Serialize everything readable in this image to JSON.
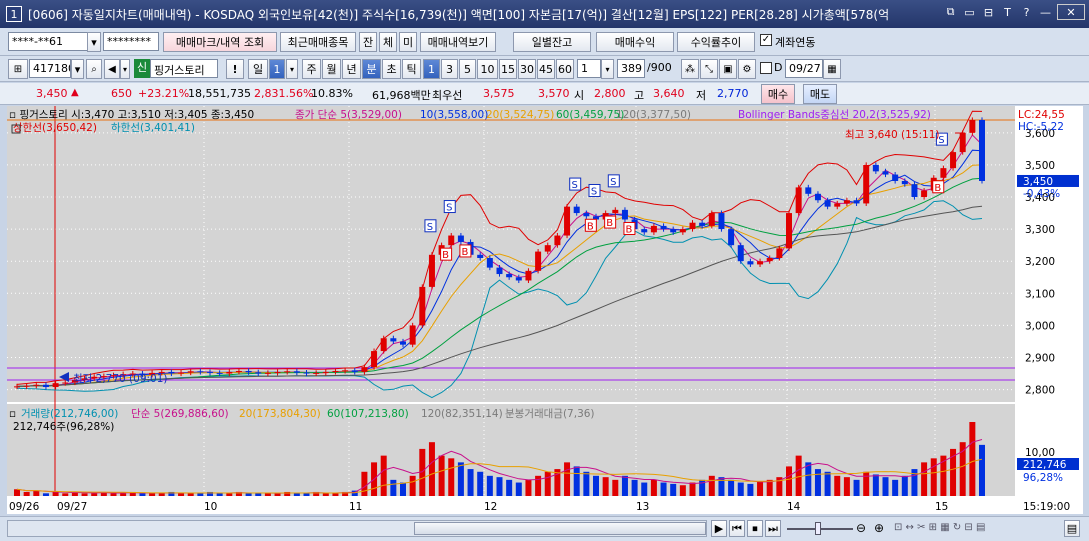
{
  "window": {
    "number": "1",
    "title": "[0606] 자동일지차트(매매내역) - KOSDAQ 외국인보유[42(천)] 주식수[16,739(천)] 액면[100] 자본금[17(억)] 결산[12월] EPS[122] PER[28.28] 시가총액[578(억",
    "buttons": [
      "⧉",
      "▭",
      "⊟",
      "T",
      "?",
      "—",
      "✕"
    ]
  },
  "toolbar1": {
    "account": "****-**61",
    "password": "********",
    "btn_trade_mark": "매매마크/내역 조회",
    "btn_recent": "최근매매종목",
    "btn_jan": "잔",
    "btn_che": "체",
    "btn_mi": "미",
    "btn_history": "매매내역보기",
    "btn_daily_balance": "일별잔고",
    "btn_pnl": "매매수익",
    "btn_return": "수익률추이",
    "link_account_label": "계좌연동",
    "link_account_checked": true
  },
  "toolbar2": {
    "code": "417180",
    "shin": "신",
    "name": "핑거스토리",
    "alert": "!",
    "period_il": "일",
    "period_num": "1",
    "period_ju": "주",
    "period_wol": "월",
    "period_nyeon": "년",
    "period_bun": "분",
    "period_cho": "초",
    "period_tik": "틱",
    "minutes": [
      "1",
      "3",
      "5",
      "10",
      "15",
      "30",
      "45",
      "60"
    ],
    "interval_value": "1",
    "count": "389",
    "count_total": "/900",
    "d_label": "D",
    "date": "09/27"
  },
  "pricebar": {
    "price": "3,450",
    "arrow": "▲",
    "change": "650",
    "change_pct": "+23.21%",
    "volume": "18,551,735",
    "volume_pct": "2,831.56%",
    "turnover": "10.83%",
    "trade_value": "61,968백만",
    "best_ask_label": "최우선",
    "best_ask": "3,575",
    "best_bid": "3,570",
    "open_label": "시",
    "open": "2,800",
    "high_label": "고",
    "high": "3,640",
    "low_label": "저",
    "low": "2,770",
    "buy_btn": "매수",
    "sell_btn": "매도"
  },
  "chart_data": {
    "type": "line",
    "title": "핑거스토리 시:3,470 고:3,510 저:3,405 종:3,450",
    "legend_main": [
      {
        "name": "종가 단순 5(3,529,00)",
        "color": "#c8108c"
      },
      {
        "name": "10(3,558,00)",
        "color": "#0030e0"
      },
      {
        "name": "20(3,524,75)",
        "color": "#e8a000"
      },
      {
        "name": "60(3,459,75)",
        "color": "#00a040"
      },
      {
        "name": "120(3,377,50)",
        "color": "#7a7a7a"
      },
      {
        "name": "Bollinger Bands중심선 20,2(3,525,92)",
        "color": "#a020f0"
      }
    ],
    "legend_main2": [
      {
        "name": "상한선(3,650,42)",
        "color": "#e00000"
      },
      {
        "name": "하한선(3,401,41)",
        "color": "#0090b0"
      }
    ],
    "price_axis": [
      "3,600",
      "3,500",
      "3,400",
      "3,300",
      "3,200",
      "3,100",
      "3,000",
      "2,900",
      "2,800"
    ],
    "ylim": [
      2780,
      3640
    ],
    "lc_label": "LC:24,55",
    "hc_label": "HC:-5,22",
    "current_price": "3,450",
    "current_pct": "-0,43%",
    "high_annotation": "최고 3,640 (15:11)",
    "low_annotation": "최저 2,770 (09:01)",
    "legend_volume": [
      {
        "name": "거래량(212,746,00)",
        "color": "#0090b0"
      },
      {
        "name": "단순 5(269,886,60)",
        "color": "#c8108c"
      },
      {
        "name": "20(173,804,30)",
        "color": "#e8a000"
      },
      {
        "name": "60(107,213,80)",
        "color": "#00a040"
      },
      {
        "name": "120(82,351,14)",
        "color": "#7a7a7a"
      },
      {
        "name": "분봉거래대금(7,36)",
        "color": "#7a7a7a"
      }
    ],
    "volume_sub": "212,746주(96,28%)",
    "volume_axis": [
      "10,00"
    ],
    "volume_current": "212,746",
    "volume_current_pct": "96,28%",
    "x_labels": [
      "09/26",
      "09/27",
      "10",
      "11",
      "12",
      "13",
      "14",
      "15"
    ],
    "time_label": "15:19:00",
    "trade_marks": [
      "S",
      "B",
      "S",
      "B",
      "S",
      "B",
      "S",
      "B",
      "S",
      "B",
      "S",
      "B"
    ],
    "price_series": [
      2810,
      2812,
      2815,
      2808,
      2820,
      2822,
      2830,
      2835,
      2840,
      2842,
      2845,
      2848,
      2850,
      2846,
      2852,
      2855,
      2850,
      2853,
      2857,
      2855,
      2852,
      2850,
      2855,
      2858,
      2854,
      2850,
      2852,
      2855,
      2857,
      2853,
      2850,
      2852,
      2855,
      2858,
      2860,
      2855,
      2870,
      2920,
      2960,
      2950,
      2940,
      3000,
      3120,
      3220,
      3250,
      3280,
      3260,
      3220,
      3210,
      3180,
      3160,
      3150,
      3140,
      3170,
      3230,
      3250,
      3280,
      3370,
      3350,
      3340,
      3330,
      3350,
      3360,
      3330,
      3300,
      3290,
      3310,
      3300,
      3290,
      3300,
      3320,
      3310,
      3350,
      3300,
      3250,
      3200,
      3190,
      3200,
      3210,
      3240,
      3350,
      3430,
      3410,
      3390,
      3370,
      3380,
      3390,
      3380,
      3500,
      3480,
      3470,
      3450,
      3440,
      3400,
      3420,
      3460,
      3490,
      3540,
      3600,
      3640,
      3450
    ],
    "volume_series": [
      5,
      3,
      4,
      2,
      3,
      2,
      3,
      2,
      2,
      3,
      2,
      2,
      3,
      2,
      2,
      2,
      3,
      2,
      2,
      2,
      3,
      2,
      2,
      3,
      2,
      2,
      2,
      2,
      3,
      2,
      2,
      3,
      2,
      2,
      3,
      4,
      18,
      25,
      30,
      12,
      10,
      15,
      35,
      40,
      30,
      28,
      25,
      20,
      18,
      15,
      14,
      12,
      10,
      12,
      15,
      18,
      20,
      25,
      22,
      18,
      15,
      14,
      12,
      15,
      12,
      10,
      12,
      10,
      9,
      8,
      10,
      12,
      15,
      14,
      12,
      10,
      9,
      11,
      12,
      14,
      22,
      30,
      25,
      20,
      18,
      15,
      14,
      12,
      18,
      16,
      14,
      12,
      15,
      20,
      25,
      28,
      30,
      35,
      40,
      55,
      38
    ]
  },
  "scroll": {
    "buttons": [
      "◀",
      "▶",
      "⏮",
      "⏹",
      "⏭",
      "▶"
    ],
    "zoom_minus": "⊖",
    "zoom_plus": "⊕"
  }
}
